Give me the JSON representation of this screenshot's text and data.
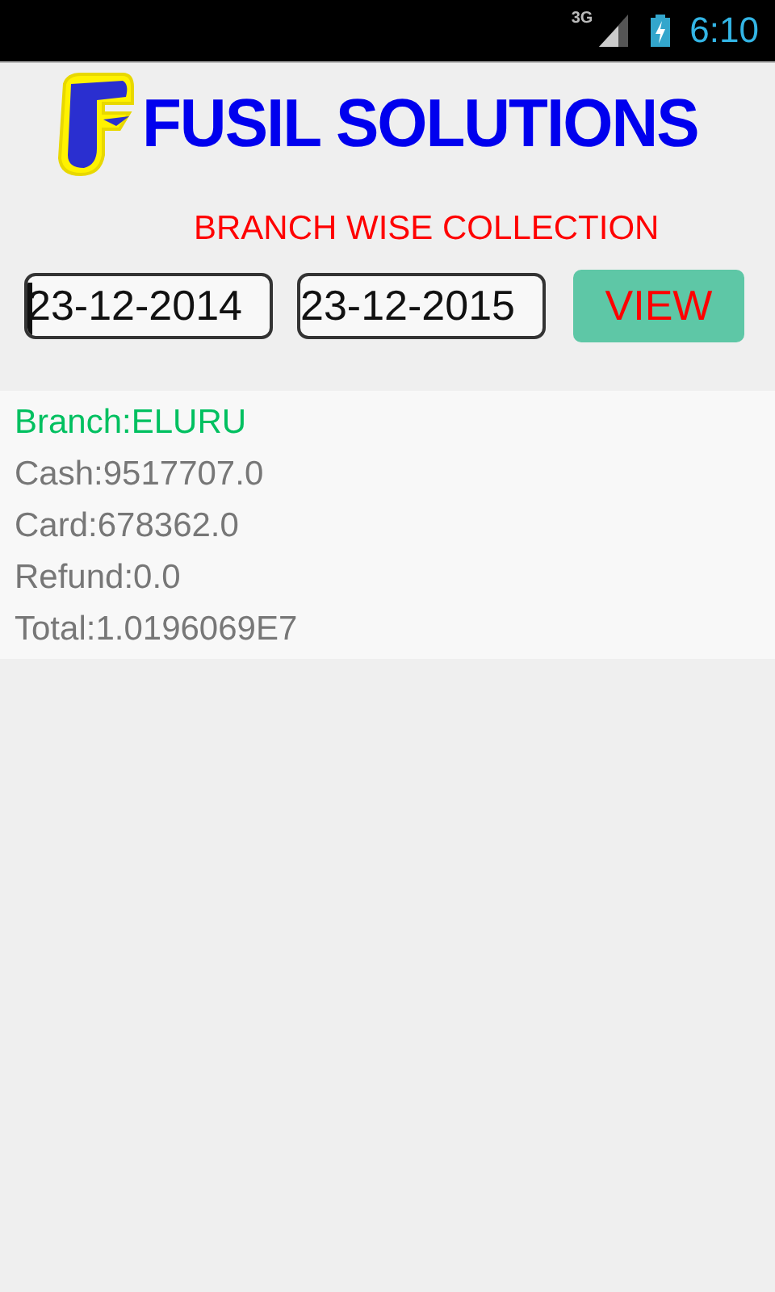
{
  "status_bar": {
    "network": "3G",
    "time": "6:10"
  },
  "header": {
    "title": "FUSIL SOLUTIONS"
  },
  "subtitle": "BRANCH WISE COLLECTION",
  "date_fields": [
    {
      "value": "23-12-2014",
      "focused": true
    },
    {
      "value": "23-12-2015",
      "focused": false
    }
  ],
  "view_button": "VIEW",
  "results": [
    {
      "kind": "branch",
      "text": "Branch:ELURU"
    },
    {
      "kind": "amount",
      "text": "Cash:9517707.0"
    },
    {
      "kind": "amount",
      "text": "Card:678362.0"
    },
    {
      "kind": "amount",
      "text": "Refund:0.0"
    },
    {
      "kind": "amount",
      "text": "Total:1.0196069E7"
    }
  ]
}
